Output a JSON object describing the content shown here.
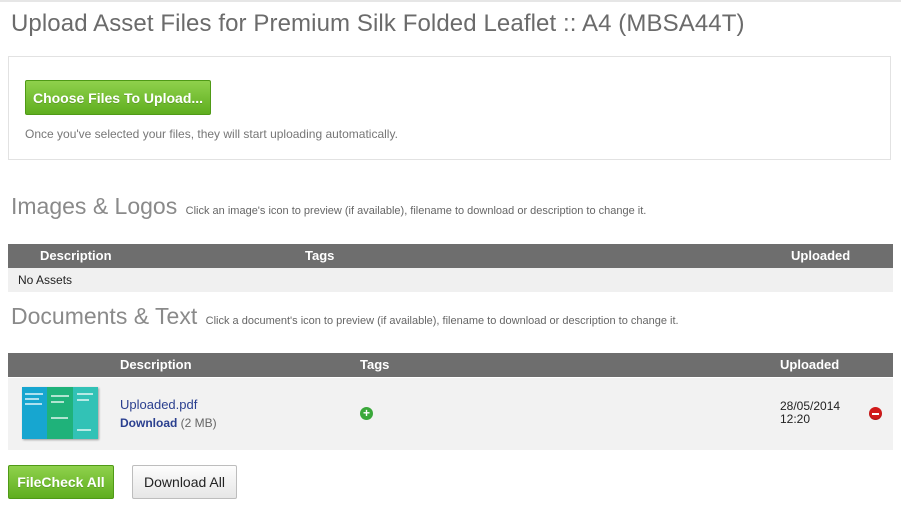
{
  "page": {
    "title": "Upload Asset Files for Premium Silk Folded Leaflet :: A4 (MBSA44T)"
  },
  "upload": {
    "button_label": "Choose Files To Upload...",
    "help_text": "Once you've selected your files, they will start uploading automatically."
  },
  "images_section": {
    "title": "Images & Logos",
    "hint": "Click an image's icon to preview (if available), filename to download or description to change it.",
    "columns": {
      "description": "Description",
      "tags": "Tags",
      "uploaded": "Uploaded"
    },
    "empty_text": "No Assets"
  },
  "documents_section": {
    "title": "Documents & Text",
    "hint": "Click a document's icon to preview (if available), filename to download or description to change it.",
    "columns": {
      "description": "Description",
      "tags": "Tags",
      "uploaded": "Uploaded"
    },
    "rows": [
      {
        "filename": "Uploaded.pdf",
        "download_label": "Download",
        "size": "(2 MB)",
        "uploaded_date": "28/05/2014",
        "uploaded_time": "12:20",
        "add_tag_icon": "plus-circle-icon",
        "remove_icon": "minus-circle-icon"
      }
    ]
  },
  "actions": {
    "filecheck_all": "FileCheck All",
    "download_all": "Download All"
  },
  "colors": {
    "accent_green": "#6bbf2a",
    "table_header": "#6e6e6e",
    "link": "#2a3f8f",
    "remove_red": "#d11a1a"
  }
}
